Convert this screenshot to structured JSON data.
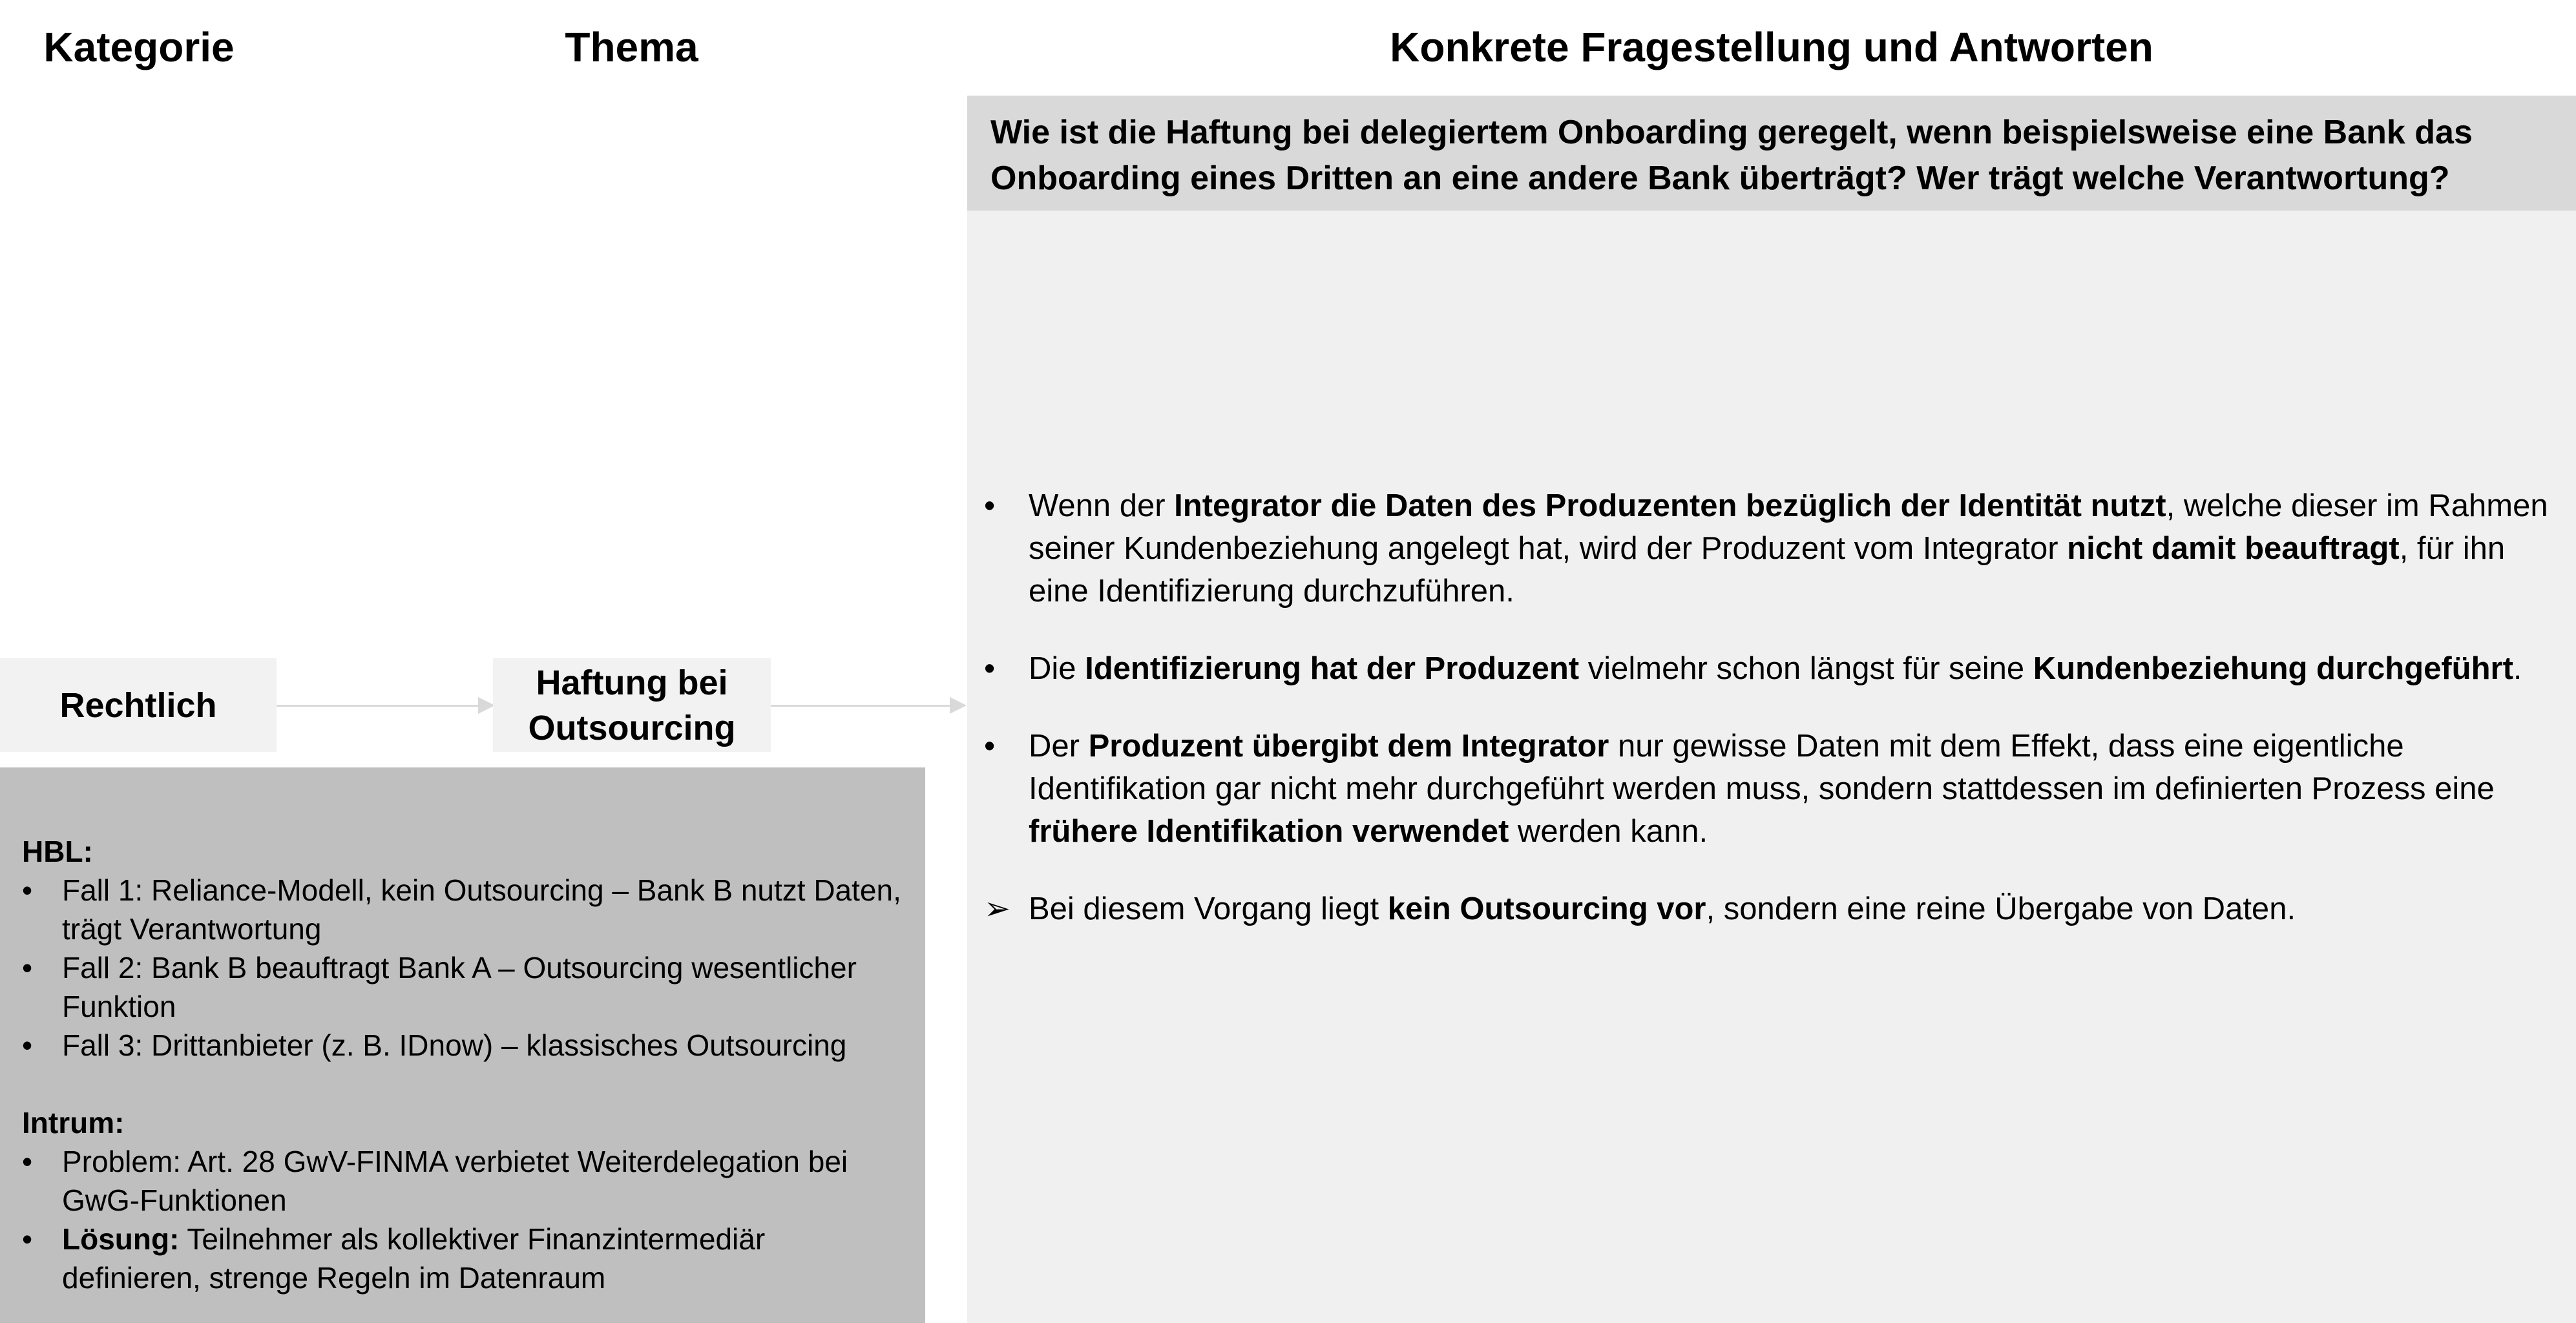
{
  "headers": {
    "kategorie": "Kategorie",
    "thema": "Thema",
    "frage": "Konkrete Fragestellung und Antworten"
  },
  "question": {
    "line1": "Wie ist die Haftung bei delegiertem Onboarding geregelt, wenn beispielsweise eine Bank das",
    "line2": "Onboarding eines Dritten an eine andere Bank überträgt? Wer trägt welche Verantwortung?"
  },
  "flow": {
    "kategorie": "Rechtlich",
    "thema_line1": "Haftung bei",
    "thema_line2": "Outsourcing"
  },
  "answers": [
    {
      "marker": "•",
      "parts": [
        {
          "text": "Wenn der ",
          "bold": false
        },
        {
          "text": "Integrator die Daten des Produzenten bezüglich der Identität nutzt",
          "bold": true
        },
        {
          "text": ", welche dieser im Rahmen seiner Kundenbeziehung angelegt hat, wird der Produzent vom Integrator ",
          "bold": false
        },
        {
          "text": "nicht damit beauftragt",
          "bold": true
        },
        {
          "text": ", für ihn eine Identifizierung durchzuführen.",
          "bold": false
        }
      ]
    },
    {
      "marker": "•",
      "parts": [
        {
          "text": "Die ",
          "bold": false
        },
        {
          "text": "Identifizierung hat der Produzent",
          "bold": true
        },
        {
          "text": " vielmehr schon längst für seine ",
          "bold": false
        },
        {
          "text": "Kundenbeziehung durchgeführt",
          "bold": true
        },
        {
          "text": ".",
          "bold": false
        }
      ]
    },
    {
      "marker": "•",
      "parts": [
        {
          "text": "Der ",
          "bold": false
        },
        {
          "text": "Produzent übergibt dem Integrator",
          "bold": true
        },
        {
          "text": " nur gewisse Daten mit dem Effekt, dass eine eigentliche Identifikation gar nicht mehr durchgeführt werden muss, sondern stattdessen im definierten Prozess eine ",
          "bold": false
        },
        {
          "text": "frühere Identifikation verwendet",
          "bold": true
        },
        {
          "text": " werden kann.",
          "bold": false
        }
      ]
    },
    {
      "marker": "➢",
      "parts": [
        {
          "text": "Bei diesem Vorgang liegt ",
          "bold": false
        },
        {
          "text": "kein Outsourcing vor",
          "bold": true
        },
        {
          "text": ", sondern eine reine Übergabe von Daten.",
          "bold": false
        }
      ]
    }
  ],
  "notes": [
    {
      "title": "HBL:",
      "items": [
        [
          {
            "text": "Fall 1: Reliance-Modell, kein Outsourcing – Bank B nutzt Daten, trägt Verantwortung",
            "bold": false
          }
        ],
        [
          {
            "text": "Fall 2: Bank B beauftragt Bank A – Outsourcing wesentlicher Funktion",
            "bold": false
          }
        ],
        [
          {
            "text": "Fall 3: Drittanbieter (z. B. IDnow) – klassisches Outsourcing",
            "bold": false
          }
        ]
      ]
    },
    {
      "title": "Intrum:",
      "items": [
        [
          {
            "text": "Problem: Art. 28 GwV-FINMA verbietet Weiterdelegation bei GwG-Funktionen",
            "bold": false
          }
        ],
        [
          {
            "text": "Lösung:",
            "bold": true
          },
          {
            "text": " Teilnehmer als kollektiver Finanzintermediär definieren, strenge Regeln im Datenraum",
            "bold": false
          }
        ]
      ]
    }
  ]
}
